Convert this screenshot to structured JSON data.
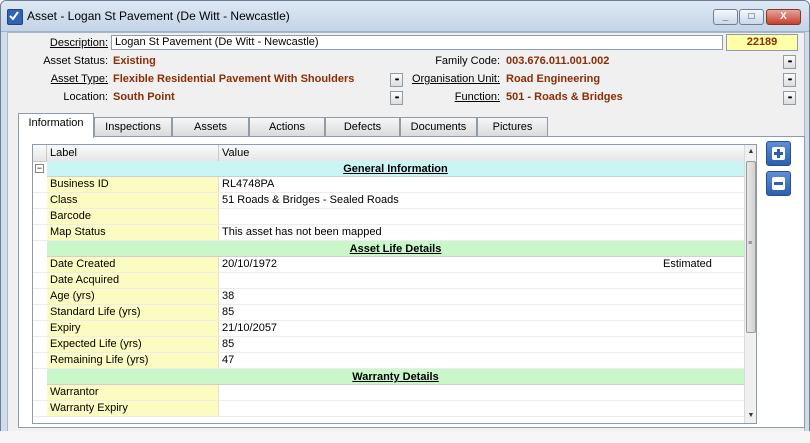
{
  "window": {
    "title": "Asset - Logan St Pavement (De Witt - Newcastle)",
    "minimize_glyph": "_",
    "maximize_glyph": "□",
    "close_glyph": "X"
  },
  "header": {
    "description_label": "Description:",
    "description_value": "Logan St Pavement (De Witt - Newcastle)",
    "asset_id": "22189",
    "asset_status_label": "Asset Status:",
    "asset_status_value": "Existing",
    "asset_type_label": "Asset Type:",
    "asset_type_value": "Flexible Residential Pavement With Shoulders",
    "location_label": "Location:",
    "location_value": "South Point",
    "family_code_label": "Family Code:",
    "family_code_value": "003.676.011.001.002",
    "org_unit_label": "Organisation Unit:",
    "org_unit_value": "Road Engineering",
    "function_label": "Function:",
    "function_value": "501 - Roads & Bridges",
    "lookup_glyph": "••"
  },
  "tabs": [
    {
      "label": "Information",
      "active": true
    },
    {
      "label": "Inspections"
    },
    {
      "label": "Assets"
    },
    {
      "label": "Actions"
    },
    {
      "label": "Defects"
    },
    {
      "label": "Documents"
    },
    {
      "label": "Pictures"
    }
  ],
  "grid": {
    "columns": [
      "Label",
      "Value"
    ],
    "collapse_glyph": "−",
    "sections": [
      {
        "title": "General Information",
        "rows": [
          {
            "label": "Business ID",
            "value": "RL4748PA"
          },
          {
            "label": "Class",
            "value": "51 Roads & Bridges - Sealed Roads"
          },
          {
            "label": "Barcode",
            "value": ""
          },
          {
            "label": "Map Status",
            "value": "This asset has not been mapped"
          }
        ]
      },
      {
        "title": "Asset Life Details",
        "rows": [
          {
            "label": "Date Created",
            "value": "20/10/1972",
            "extra": "Estimated"
          },
          {
            "label": "Date Acquired",
            "value": ""
          },
          {
            "label": "Age (yrs)",
            "value": "38"
          },
          {
            "label": "Standard Life (yrs)",
            "value": "85"
          },
          {
            "label": "Expiry",
            "value": "21/10/2057"
          },
          {
            "label": "Expected Life (yrs)",
            "value": "85"
          },
          {
            "label": "Remaining Life (yrs)",
            "value": "47"
          }
        ]
      },
      {
        "title": "Warranty Details",
        "rows": [
          {
            "label": "Warrantor",
            "value": ""
          },
          {
            "label": "Warranty Expiry",
            "value": ""
          }
        ]
      }
    ]
  },
  "colors": {
    "section_bg_general": "#c9f5f5",
    "section_bg_other": "#c9f7c9",
    "value_text": "#8b2e07"
  },
  "side_buttons": {
    "add_icon": "plus-icon",
    "remove_icon": "minus-icon"
  }
}
